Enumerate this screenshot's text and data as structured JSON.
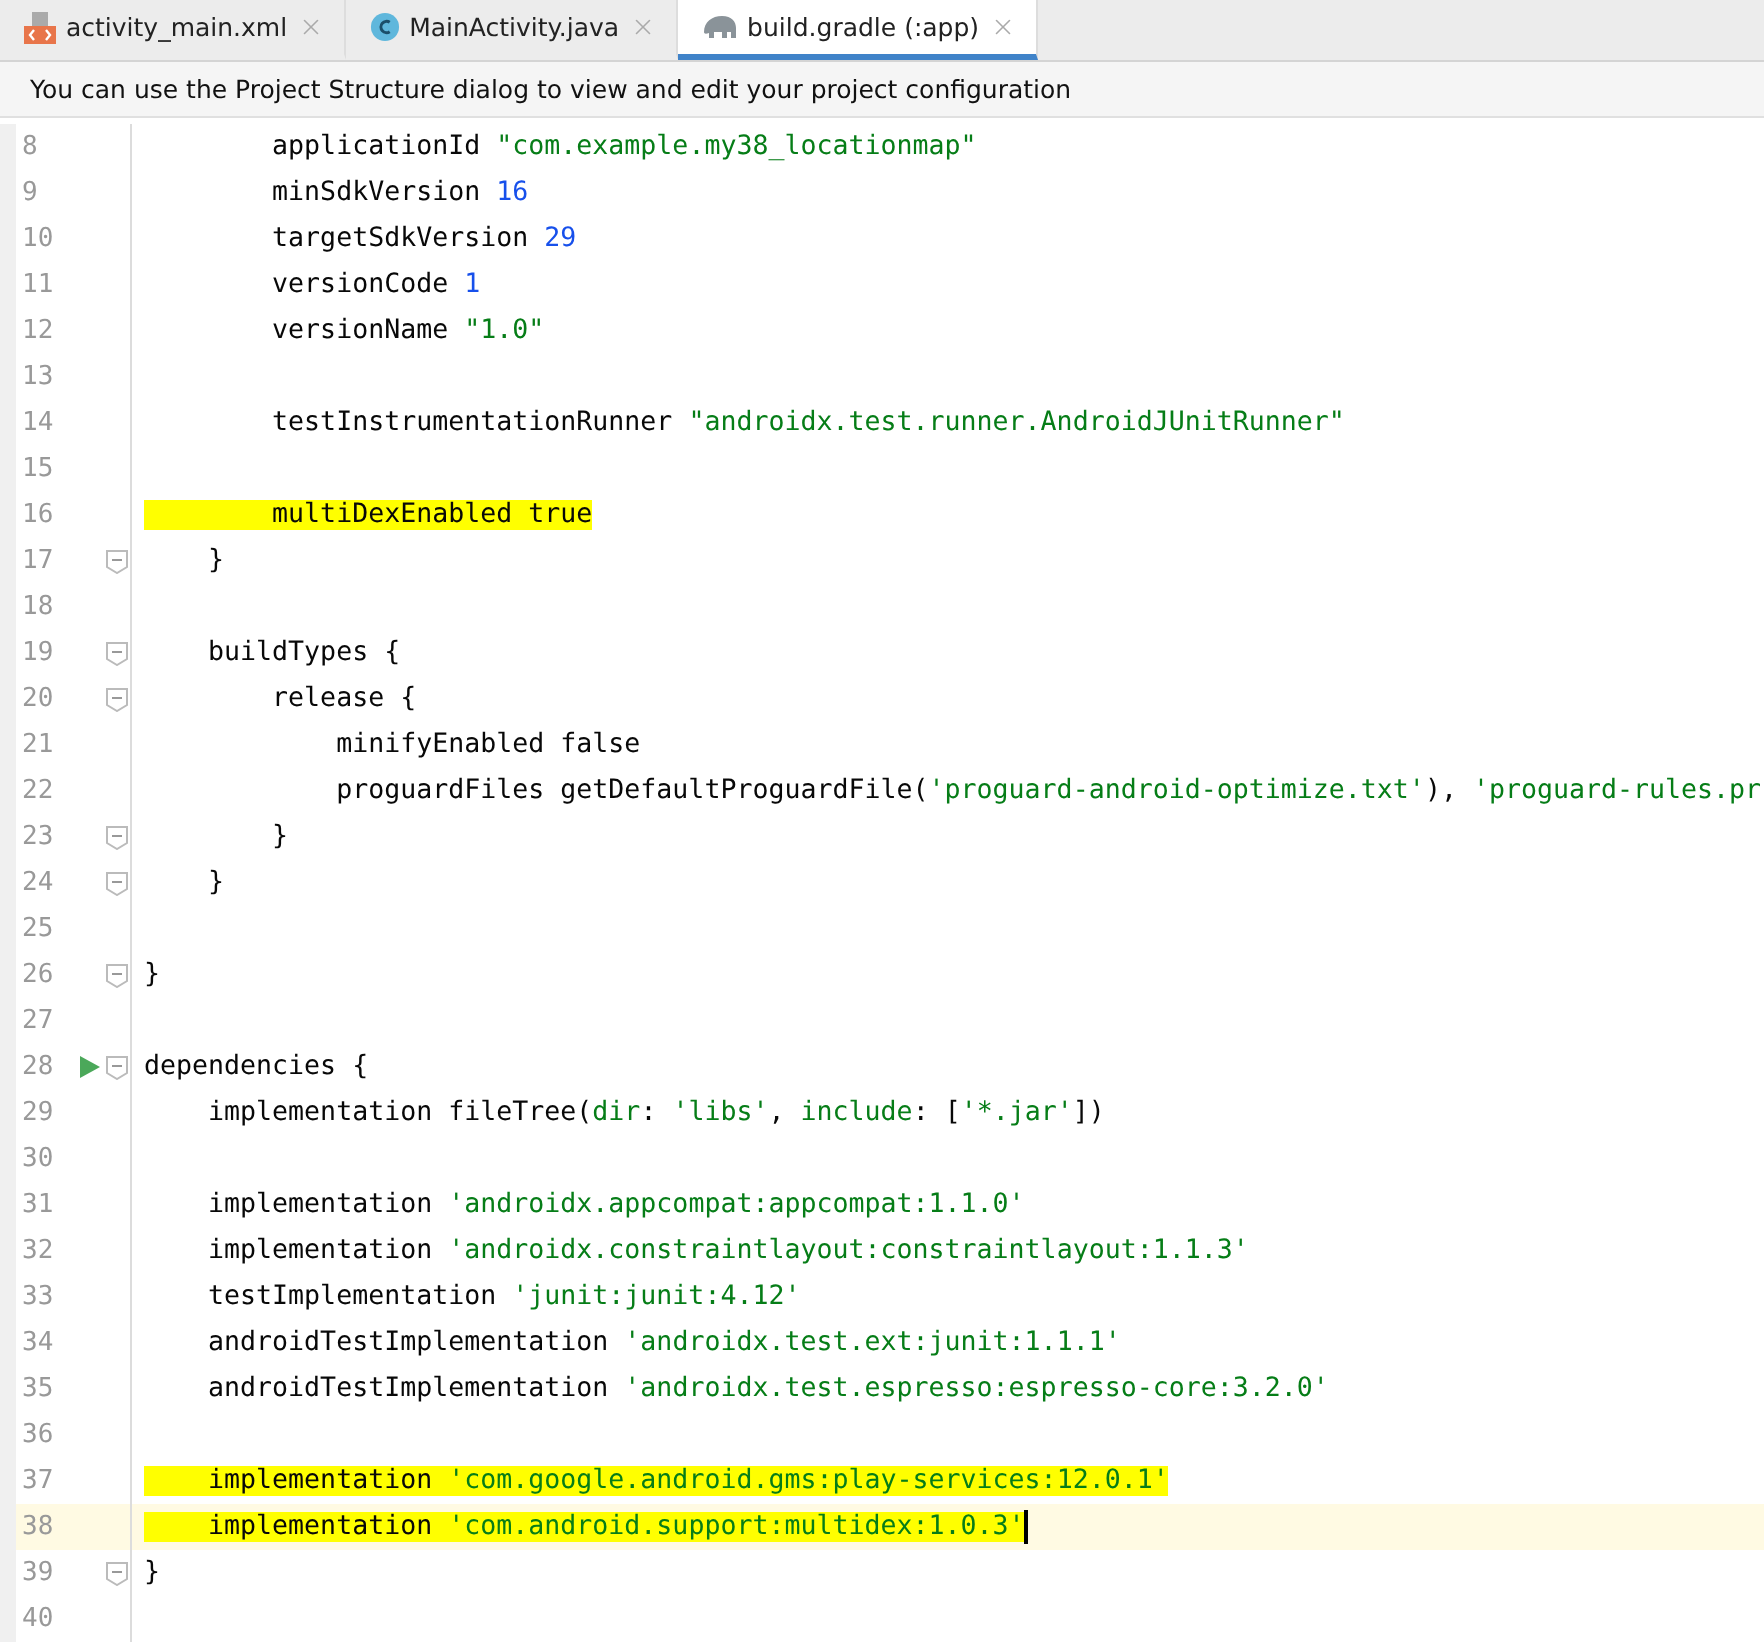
{
  "tabs": [
    {
      "label": "activity_main.xml",
      "kind": "xml",
      "selected": false
    },
    {
      "label": "MainActivity.java",
      "kind": "class",
      "selected": false
    },
    {
      "label": "build.gradle (:app)",
      "kind": "gradle",
      "selected": true
    }
  ],
  "banner": "You can use the Project Structure dialog to view and edit your project configuration",
  "lines": [
    {
      "number": "8",
      "tokens": [
        {
          "kind": "plain",
          "text": "        applicationId "
        },
        {
          "kind": "string",
          "text": "\"com.example.my38_locationmap\""
        }
      ]
    },
    {
      "number": "9",
      "tokens": [
        {
          "kind": "plain",
          "text": "        minSdkVersion "
        },
        {
          "kind": "number",
          "text": "16"
        }
      ]
    },
    {
      "number": "10",
      "tokens": [
        {
          "kind": "plain",
          "text": "        targetSdkVersion "
        },
        {
          "kind": "number",
          "text": "29"
        }
      ]
    },
    {
      "number": "11",
      "tokens": [
        {
          "kind": "plain",
          "text": "        versionCode "
        },
        {
          "kind": "number",
          "text": "1"
        }
      ]
    },
    {
      "number": "12",
      "tokens": [
        {
          "kind": "plain",
          "text": "        versionName "
        },
        {
          "kind": "string",
          "text": "\"1.0\""
        }
      ]
    },
    {
      "number": "13"
    },
    {
      "number": "14",
      "tokens": [
        {
          "kind": "plain",
          "text": "        testInstrumentationRunner "
        },
        {
          "kind": "string",
          "text": "\"androidx.test.runner.AndroidJUnitRunner\""
        }
      ]
    },
    {
      "number": "15"
    },
    {
      "number": "16",
      "highlighted": true,
      "tokens": [
        {
          "kind": "plain",
          "text": "        multiDexEnabled true"
        }
      ]
    },
    {
      "number": "17",
      "fold": true,
      "tokens": [
        {
          "kind": "plain",
          "text": "    }"
        }
      ]
    },
    {
      "number": "18"
    },
    {
      "number": "19",
      "fold": true,
      "tokens": [
        {
          "kind": "plain",
          "text": "    buildTypes {"
        }
      ]
    },
    {
      "number": "20",
      "fold": true,
      "tokens": [
        {
          "kind": "plain",
          "text": "        release {"
        }
      ]
    },
    {
      "number": "21",
      "tokens": [
        {
          "kind": "plain",
          "text": "            minifyEnabled false"
        }
      ]
    },
    {
      "number": "22",
      "tokens": [
        {
          "kind": "plain",
          "text": "            proguardFiles getDefaultProguardFile("
        },
        {
          "kind": "string",
          "text": "'proguard-android-optimize.txt'"
        },
        {
          "kind": "plain",
          "text": "), "
        },
        {
          "kind": "string",
          "text": "'proguard-rules.pr"
        }
      ]
    },
    {
      "number": "23",
      "fold": true,
      "tokens": [
        {
          "kind": "plain",
          "text": "        }"
        }
      ]
    },
    {
      "number": "24",
      "fold": true,
      "tokens": [
        {
          "kind": "plain",
          "text": "    }"
        }
      ]
    },
    {
      "number": "25"
    },
    {
      "number": "26",
      "fold": true,
      "tokens": [
        {
          "kind": "plain",
          "text": "}"
        }
      ]
    },
    {
      "number": "27"
    },
    {
      "number": "28",
      "fold": true,
      "run": true,
      "tokens": [
        {
          "kind": "plain",
          "text": "dependencies {"
        }
      ]
    },
    {
      "number": "29",
      "tokens": [
        {
          "kind": "plain",
          "text": "    implementation fileTree("
        },
        {
          "kind": "named",
          "text": "dir"
        },
        {
          "kind": "plain",
          "text": ": "
        },
        {
          "kind": "string",
          "text": "'libs'"
        },
        {
          "kind": "plain",
          "text": ", "
        },
        {
          "kind": "named",
          "text": "include"
        },
        {
          "kind": "plain",
          "text": ": ["
        },
        {
          "kind": "string",
          "text": "'*.jar'"
        },
        {
          "kind": "plain",
          "text": "])"
        }
      ]
    },
    {
      "number": "30"
    },
    {
      "number": "31",
      "tokens": [
        {
          "kind": "plain",
          "text": "    implementation "
        },
        {
          "kind": "string",
          "text": "'androidx.appcompat:appcompat:1.1.0'"
        }
      ]
    },
    {
      "number": "32",
      "tokens": [
        {
          "kind": "plain",
          "text": "    implementation "
        },
        {
          "kind": "string",
          "text": "'androidx.constraintlayout:constraintlayout:1.1.3'"
        }
      ]
    },
    {
      "number": "33",
      "tokens": [
        {
          "kind": "plain",
          "text": "    testImplementation "
        },
        {
          "kind": "string",
          "text": "'junit:junit:4.12'"
        }
      ]
    },
    {
      "number": "34",
      "tokens": [
        {
          "kind": "plain",
          "text": "    androidTestImplementation "
        },
        {
          "kind": "string",
          "text": "'androidx.test.ext:junit:1.1.1'"
        }
      ]
    },
    {
      "number": "35",
      "tokens": [
        {
          "kind": "plain",
          "text": "    androidTestImplementation "
        },
        {
          "kind": "string",
          "text": "'androidx.test.espresso:espresso-core:3.2.0'"
        }
      ]
    },
    {
      "number": "36"
    },
    {
      "number": "37",
      "highlighted": true,
      "tokens": [
        {
          "kind": "plain",
          "text": "    implementation "
        },
        {
          "kind": "string",
          "text": "'com.google.android.gms:play-services:12.0.1'"
        }
      ]
    },
    {
      "number": "38",
      "highlighted": true,
      "caret": true,
      "tokens": [
        {
          "kind": "plain",
          "text": "    implementation "
        },
        {
          "kind": "string",
          "text": "'com.android.support:multidex:1.0.3'"
        }
      ]
    },
    {
      "number": "39",
      "fold": true,
      "tokens": [
        {
          "kind": "plain",
          "text": "}"
        }
      ]
    },
    {
      "number": "40"
    }
  ]
}
